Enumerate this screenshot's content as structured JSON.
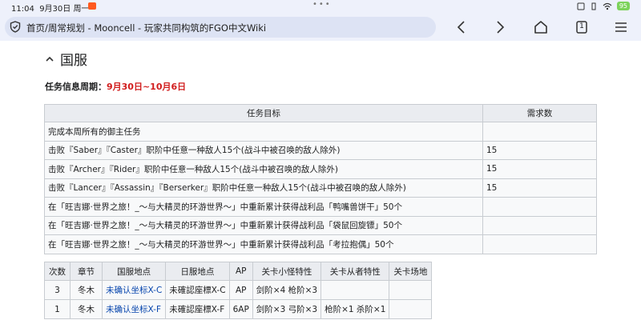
{
  "status_bar": {
    "time": "11:04",
    "date": "9月30日 周一",
    "battery": "95"
  },
  "browser": {
    "url_title": "首页/周常规划 - Mooncell - 玩家共同构筑的FGO中文Wiki",
    "tab_count": "1"
  },
  "section": {
    "title": "国服",
    "period_label": "任务信息周期：",
    "period_dates": "9月30日~10月6日"
  },
  "task_table": {
    "headers": [
      "任务目标",
      "需求数"
    ],
    "rows": [
      {
        "goal": "完成本周所有的御主任务",
        "count": ""
      },
      {
        "goal": "击败『Saber』『Caster』职阶中任意一种敌人15个(战斗中被召唤的敌人除外)",
        "count": "15"
      },
      {
        "goal": "击败『Archer』『Rider』职阶中任意一种敌人15个(战斗中被召唤的敌人除外)",
        "count": "15"
      },
      {
        "goal": "击败『Lancer』『Assassin』『Berserker』职阶中任意一种敌人15个(战斗中被召唤的敌人除外)",
        "count": "15"
      },
      {
        "goal": "在「旺吉娜·世界之旅！_～与大精灵的环游世界～」中重新累计获得战利品「鸭嘴兽饼干」50个",
        "count": ""
      },
      {
        "goal": "在「旺吉娜·世界之旅！_～与大精灵的环游世界～」中重新累计获得战利品「袋鼠回旋镖」50个",
        "count": ""
      },
      {
        "goal": "在「旺吉娜·世界之旅！_～与大精灵的环游世界～」中重新累计获得战利品「考拉抱偶」50个",
        "count": ""
      }
    ]
  },
  "stage_table": {
    "headers": [
      "次数",
      "章节",
      "国服地点",
      "日服地点",
      "AP",
      "关卡小怪特性",
      "关卡从者特性",
      "关卡场地"
    ],
    "rows": [
      {
        "times": "3",
        "chapter": "冬木",
        "cn_loc": "未确认坐标X-C",
        "jp_loc": "未確認座標X-C",
        "ap": "AP",
        "mob": "剑阶×4 枪阶×3",
        "servant": "",
        "field": ""
      },
      {
        "times": "1",
        "chapter": "冬木",
        "cn_loc": "未确认坐标X-F",
        "jp_loc": "未確認座標X-F",
        "ap": "6AP",
        "mob": "剑阶×3 弓阶×3",
        "servant": "枪阶×1 杀阶×1",
        "field": ""
      }
    ]
  },
  "icons": {
    "shield": "shield-icon",
    "back": "back-icon",
    "forward": "forward-icon",
    "home": "home-icon",
    "tabs": "tabs-icon",
    "menu": "menu-icon",
    "collapse": "chevron-up-icon"
  }
}
